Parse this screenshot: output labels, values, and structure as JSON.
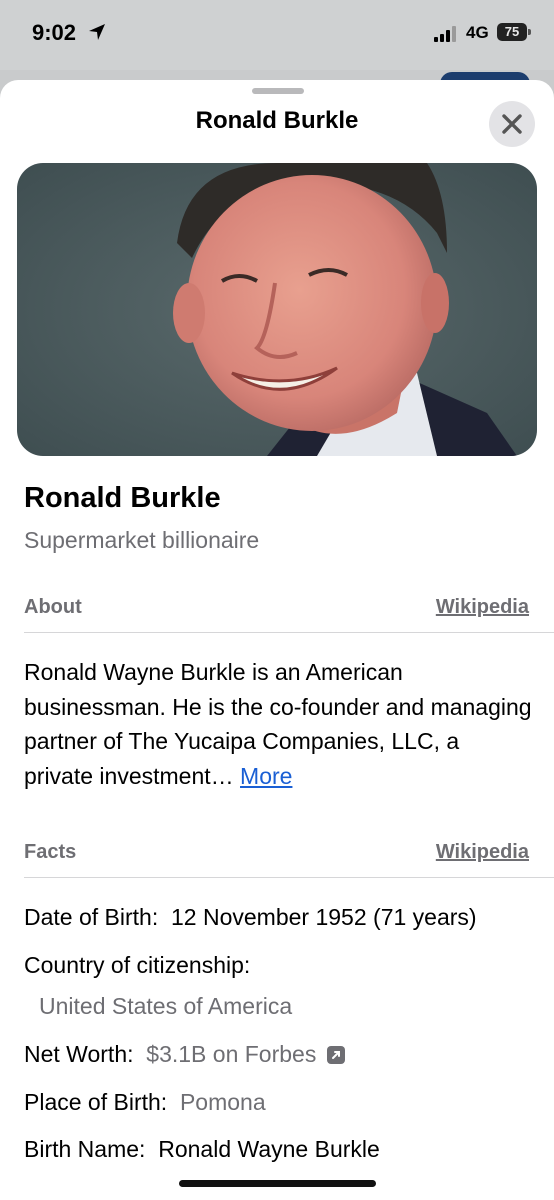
{
  "status": {
    "time": "9:02",
    "network": "4G",
    "battery": "75"
  },
  "sheet": {
    "title": "Ronald Burkle"
  },
  "profile": {
    "name": "Ronald Burkle",
    "subtitle": "Supermarket billionaire"
  },
  "about": {
    "heading": "About",
    "source": "Wikipedia",
    "text": "Ronald Wayne Burkle is an American businessman. He is the co-founder and managing partner of The Yucaipa Companies, LLC, a private investment…",
    "more": "More"
  },
  "facts": {
    "heading": "Facts",
    "source": "Wikipedia",
    "items": [
      {
        "label": "Date of Birth:",
        "value": "12 November 1952 (71 years)"
      },
      {
        "label": "Country of citizenship:",
        "value": "United States of America"
      },
      {
        "label": "Net Worth:",
        "value": "$3.1B on Forbes"
      },
      {
        "label": "Place of Birth:",
        "value": "Pomona"
      },
      {
        "label": "Birth Name:",
        "value": "Ronald Wayne Burkle"
      }
    ]
  },
  "colors": {
    "accent_link": "#1a5fd4",
    "secondary_text": "#6e6e73",
    "sheet_bg": "#ffffff"
  }
}
